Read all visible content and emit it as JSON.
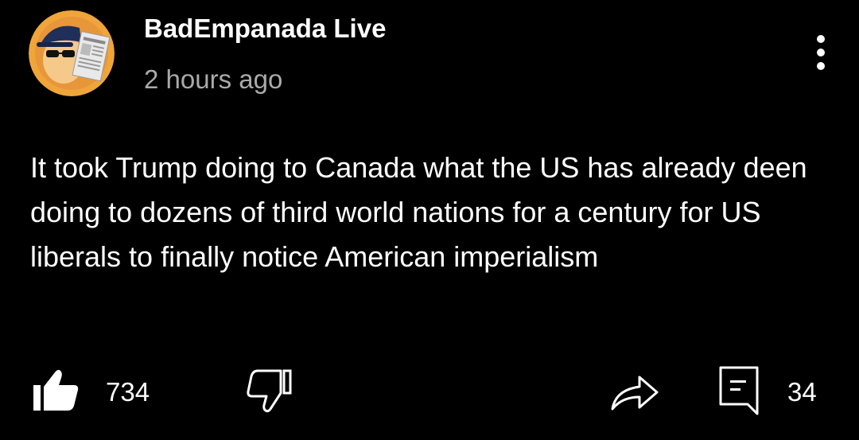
{
  "comment": {
    "author": "BadEmpanada Live",
    "timestamp": "2 hours ago",
    "text": "It took Trump doing to Canada what the US has already deen doing to dozens of third world nations for a century for US liberals to finally notice American imperialism"
  },
  "actions": {
    "like_count": "734",
    "reply_count": "34"
  },
  "icons": {
    "like": "thumbs-up-icon",
    "dislike": "thumbs-down-icon",
    "share": "share-arrow-icon",
    "reply": "comment-icon",
    "menu": "more-vertical-icon"
  },
  "colors": {
    "background": "#000000",
    "text": "#ffffff",
    "secondary_text": "#aaaaaa"
  }
}
